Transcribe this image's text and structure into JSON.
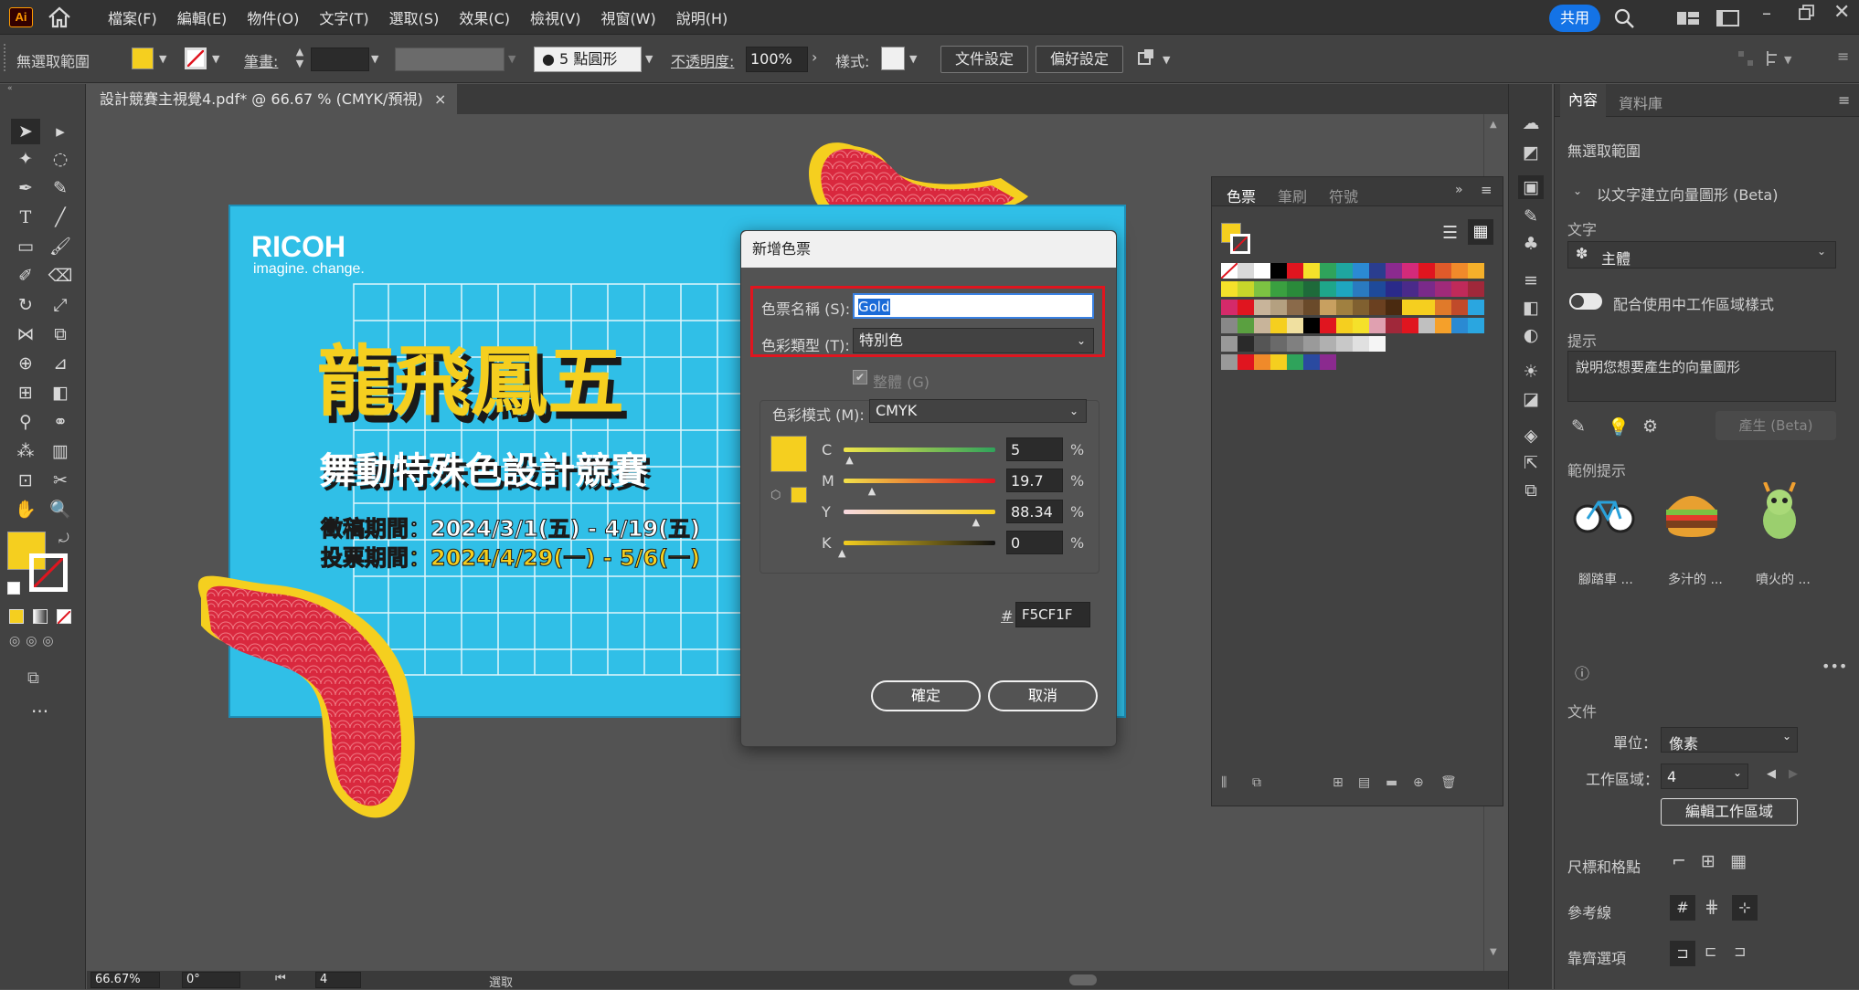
{
  "app": {
    "logo": "Ai",
    "share_label": "共用"
  },
  "menu": [
    "檔案(F)",
    "編輯(E)",
    "物件(O)",
    "文字(T)",
    "選取(S)",
    "效果(C)",
    "檢視(V)",
    "視窗(W)",
    "說明(H)"
  ],
  "control_bar": {
    "no_selection": "無選取範圍",
    "stroke_label": "筆畫:",
    "brush_label": "5 點圓形",
    "opacity_label": "不透明度:",
    "opacity_value": "100%",
    "style_label": "樣式:",
    "doc_setup": "文件設定",
    "preferences": "偏好設定"
  },
  "document_tab": {
    "title": "設計競賽主視覺4.pdf* @ 66.67 % (CMYK/預視)"
  },
  "artwork": {
    "brand": "RICOH",
    "tagline": "imagine. change.",
    "headline": "龍飛鳳五",
    "subhead": "舞動特殊色設計競賽",
    "line1": "徵稿期間：2024/3/1(五) - 4/19(五)",
    "line2": "投票期間：2024/4/29(一) - 5/6(一)"
  },
  "dialog": {
    "title": "新增色票",
    "name_label": "色票名稱 (S):",
    "name_value": "Gold",
    "type_label": "色彩類型 (T):",
    "type_value": "特別色",
    "global_label": "整體 (G)",
    "mode_label": "色彩模式 (M):",
    "mode_value": "CMYK",
    "channels": [
      {
        "name": "C",
        "value": "5",
        "fraction": 0.05
      },
      {
        "name": "M",
        "value": "19.7",
        "fraction": 0.197
      },
      {
        "name": "Y",
        "value": "88.34",
        "fraction": 0.8834
      },
      {
        "name": "K",
        "value": "0",
        "fraction": 0
      }
    ],
    "percent": "%",
    "hash": "#",
    "hex": "F5CF1F",
    "ok": "確定",
    "cancel": "取消"
  },
  "swatches_panel": {
    "tabs": [
      "色票",
      "筆刷",
      "符號"
    ]
  },
  "right_panel": {
    "tabs": [
      "內容",
      "資料庫"
    ],
    "no_selection": "無選取範圍",
    "vector_title": "以文字建立向量圖形 (Beta)",
    "text_label": "文字",
    "subject": "主體",
    "match_style": "配合使用中工作區域樣式",
    "prompt_label": "提示",
    "prompt_placeholder": "說明您想要產生的向量圖形",
    "generate": "產生 (Beta)",
    "examples_label": "範例提示",
    "examples": [
      "腳踏車 ...",
      "多汁的 ...",
      "噴火的 ..."
    ],
    "document_label": "文件",
    "unit_label": "單位：",
    "unit_value": "像素",
    "artboard_label": "工作區域：",
    "artboard_value": "4",
    "edit_artboards": "編輯工作區域",
    "rulers_grids": "尺標和格點",
    "guides": "參考線",
    "snap": "靠齊選項"
  },
  "status": {
    "zoom": "66.67%",
    "rotate": "0°",
    "artboard": "4",
    "mode": "選取"
  },
  "colors": {
    "gold": "#f5cf1f",
    "cyan": "#30bfe7",
    "red": "#d9283e",
    "accent": "#1473e6"
  }
}
